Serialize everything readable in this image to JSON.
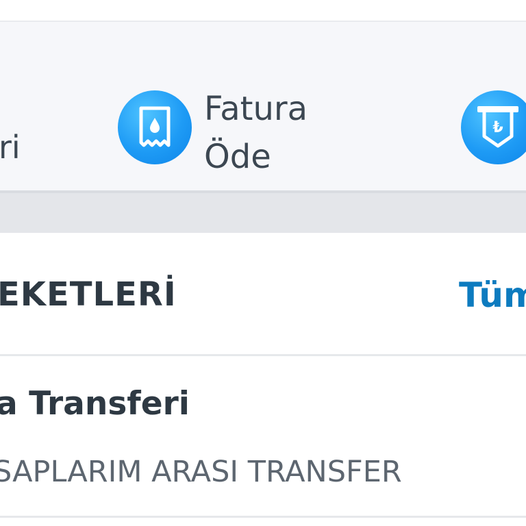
{
  "quick_actions": {
    "partial_left_label": "ri",
    "bill_pay": {
      "label_line1": "Fatura",
      "label_line2": "Öde",
      "icon": "bill-receipt-icon"
    },
    "transfer": {
      "icon": "atm-lira-icon",
      "symbol": "₺"
    },
    "accent_color": "#1e9bf5"
  },
  "section": {
    "title": "EKETLERİ",
    "see_all_label": "Tüm"
  },
  "list": {
    "items": [
      {
        "title": "a Transferi",
        "subtitle": "SAPLARIM ARASI TRANSFER"
      }
    ]
  },
  "colors": {
    "link": "#0d7bbf",
    "text_primary": "#2e3943",
    "text_secondary": "#5d6670",
    "panel_bg": "#f6f7fa",
    "separator": "#e4e6ea"
  }
}
